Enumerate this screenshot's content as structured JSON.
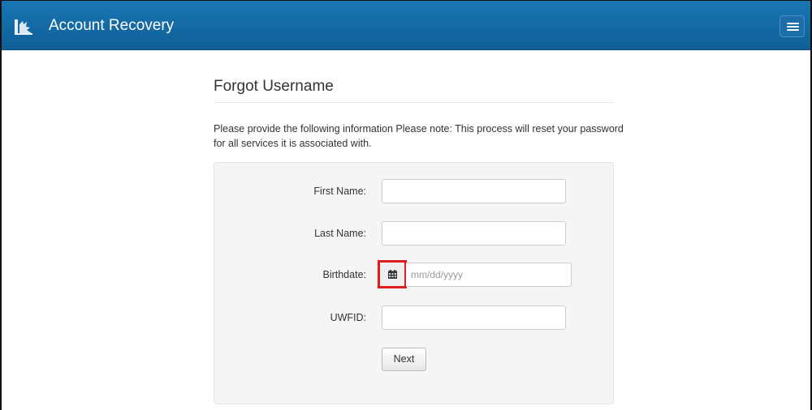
{
  "navbar": {
    "brand": "Account Recovery",
    "logo_icon": "castle-logo-icon",
    "menu_icon": "hamburger-menu-icon",
    "background": "#1570ad"
  },
  "page": {
    "title": "Forgot Username",
    "note": "Please provide the following information Please note: This process will reset your password for all services it is associated with."
  },
  "form": {
    "first_name_label": "First Name:",
    "first_name_value": "",
    "last_name_label": "Last Name:",
    "last_name_value": "",
    "birthdate_label": "Birthdate:",
    "birthdate_placeholder": "mm/dd/yyyy",
    "birthdate_icon": "calendar-icon",
    "uwfid_label": "UWFID:",
    "uwfid_value": "",
    "next_label": "Next"
  },
  "highlight_color": "#e01b1b"
}
